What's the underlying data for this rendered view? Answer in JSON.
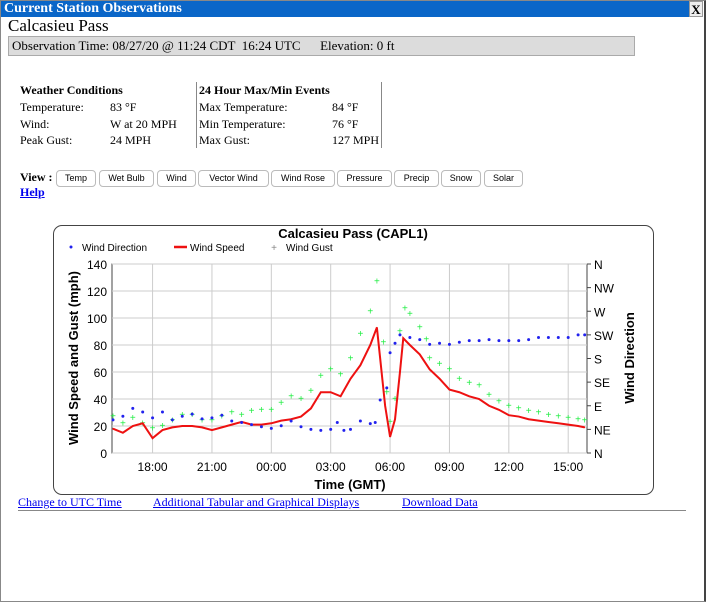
{
  "window": {
    "title": "Current Station Observations",
    "close": "X"
  },
  "station": "Calcasieu Pass",
  "obs_line": "Observation Time: 08/27/20 @ 11:24 CDT  16:24 UTC      Elevation: 0 ft",
  "conditions": {
    "heading": "Weather Conditions",
    "rows": [
      [
        "Temperature:",
        "83 °F"
      ],
      [
        "Wind:",
        "W at 20 MPH"
      ],
      [
        "Peak Gust:",
        "24 MPH"
      ]
    ]
  },
  "extremes": {
    "heading": "24 Hour Max/Min Events",
    "rows": [
      [
        "Max Temperature:",
        "84 °F"
      ],
      [
        "Min Temperature:",
        "76 °F"
      ],
      [
        "Max Gust:",
        "127 MPH"
      ]
    ]
  },
  "view": {
    "label": "View :",
    "buttons": [
      "Temp",
      "Wet Bulb",
      "Wind",
      "Vector Wind",
      "Wind Rose",
      "Pressure",
      "Precip",
      "Snow",
      "Solar"
    ],
    "help": "Help"
  },
  "links": [
    "Change to UTC Time",
    "Additional Tabular and Graphical Displays",
    "Download Data"
  ],
  "chart_data": {
    "type": "line",
    "title": "Calcasieu Pass (CAPL1)",
    "xlabel": "Time (GMT)",
    "ylabel": "Wind Speed and Gust (mph)",
    "y2label": "Wind Direction",
    "ylim": [
      0,
      140
    ],
    "yticks": [
      0,
      20,
      40,
      60,
      80,
      100,
      120,
      140
    ],
    "y2ticks": [
      "N",
      "NE",
      "E",
      "SE",
      "S",
      "SW",
      "W",
      "NW",
      "N"
    ],
    "xticks": [
      "18:00",
      "21:00",
      "00:00",
      "03:00",
      "06:00",
      "09:00",
      "12:00",
      "15:00"
    ],
    "grid": true,
    "legend": "top",
    "colors": {
      "direction": "#2222ee",
      "speed": "#ee1111",
      "gust": "#22ee44"
    },
    "series": [
      {
        "name": "Wind Direction",
        "marker": "dot",
        "unit": "deg",
        "points": [
          [
            "16:00",
            63
          ],
          [
            "16:30",
            70
          ],
          [
            "17:00",
            85
          ],
          [
            "17:30",
            78
          ],
          [
            "18:00",
            67
          ],
          [
            "18:30",
            78
          ],
          [
            "19:00",
            63
          ],
          [
            "19:30",
            70
          ],
          [
            "20:00",
            74
          ],
          [
            "20:30",
            65
          ],
          [
            "21:00",
            67
          ],
          [
            "21:30",
            72
          ],
          [
            "22:00",
            61
          ],
          [
            "22:30",
            58
          ],
          [
            "23:00",
            54
          ],
          [
            "23:30",
            50
          ],
          [
            "00:00",
            47
          ],
          [
            "00:30",
            52
          ],
          [
            "01:00",
            61
          ],
          [
            "01:30",
            50
          ],
          [
            "02:00",
            45
          ],
          [
            "02:30",
            43
          ],
          [
            "03:00",
            45
          ],
          [
            "03:20",
            58
          ],
          [
            "03:40",
            43
          ],
          [
            "04:00",
            45
          ],
          [
            "04:30",
            61
          ],
          [
            "05:00",
            56
          ],
          [
            "05:15",
            58
          ],
          [
            "05:30",
            101
          ],
          [
            "05:50",
            124
          ],
          [
            "06:00",
            191
          ],
          [
            "06:15",
            209
          ],
          [
            "06:30",
            225
          ],
          [
            "07:00",
            220
          ],
          [
            "07:30",
            216
          ],
          [
            "08:00",
            207
          ],
          [
            "08:30",
            209
          ],
          [
            "09:00",
            207
          ],
          [
            "09:30",
            211
          ],
          [
            "10:00",
            214
          ],
          [
            "10:30",
            214
          ],
          [
            "11:00",
            216
          ],
          [
            "11:30",
            214
          ],
          [
            "12:00",
            214
          ],
          [
            "12:30",
            214
          ],
          [
            "13:00",
            216
          ],
          [
            "13:30",
            220
          ],
          [
            "14:00",
            220
          ],
          [
            "14:30",
            220
          ],
          [
            "15:00",
            220
          ],
          [
            "15:30",
            225
          ],
          [
            "15:50",
            225
          ]
        ]
      },
      {
        "name": "Wind Speed",
        "marker": "line",
        "unit": "mph",
        "points": [
          [
            "16:00",
            18
          ],
          [
            "16:30",
            15
          ],
          [
            "17:00",
            20
          ],
          [
            "17:30",
            22
          ],
          [
            "18:00",
            11
          ],
          [
            "18:30",
            17
          ],
          [
            "19:00",
            19
          ],
          [
            "19:30",
            20
          ],
          [
            "20:00",
            20
          ],
          [
            "20:30",
            19
          ],
          [
            "21:00",
            17
          ],
          [
            "21:30",
            19
          ],
          [
            "22:00",
            21
          ],
          [
            "22:30",
            23
          ],
          [
            "23:00",
            21
          ],
          [
            "23:30",
            21
          ],
          [
            "00:00",
            22
          ],
          [
            "00:30",
            24
          ],
          [
            "01:00",
            25
          ],
          [
            "01:30",
            27
          ],
          [
            "02:00",
            33
          ],
          [
            "02:30",
            45
          ],
          [
            "03:00",
            45
          ],
          [
            "03:30",
            42
          ],
          [
            "04:00",
            55
          ],
          [
            "04:30",
            65
          ],
          [
            "05:00",
            80
          ],
          [
            "05:20",
            93
          ],
          [
            "05:30",
            70
          ],
          [
            "05:45",
            35
          ],
          [
            "06:00",
            12
          ],
          [
            "06:15",
            25
          ],
          [
            "06:30",
            60
          ],
          [
            "06:40",
            85
          ],
          [
            "07:00",
            80
          ],
          [
            "07:30",
            73
          ],
          [
            "08:00",
            62
          ],
          [
            "08:30",
            55
          ],
          [
            "09:00",
            47
          ],
          [
            "09:30",
            45
          ],
          [
            "10:00",
            42
          ],
          [
            "10:30",
            40
          ],
          [
            "11:00",
            35
          ],
          [
            "11:30",
            32
          ],
          [
            "12:00",
            28
          ],
          [
            "12:30",
            27
          ],
          [
            "13:00",
            25
          ],
          [
            "13:30",
            24
          ],
          [
            "14:00",
            23
          ],
          [
            "14:30",
            22
          ],
          [
            "15:00",
            21
          ],
          [
            "15:30",
            20
          ],
          [
            "15:50",
            19
          ]
        ]
      },
      {
        "name": "Wind Gust",
        "marker": "plus",
        "unit": "mph",
        "points": [
          [
            "16:00",
            27
          ],
          [
            "16:30",
            22
          ],
          [
            "17:00",
            26
          ],
          [
            "17:30",
            22
          ],
          [
            "18:00",
            18
          ],
          [
            "18:30",
            20
          ],
          [
            "19:00",
            24
          ],
          [
            "19:30",
            28
          ],
          [
            "20:00",
            28
          ],
          [
            "20:30",
            24
          ],
          [
            "21:00",
            24
          ],
          [
            "21:30",
            27
          ],
          [
            "22:00",
            30
          ],
          [
            "22:30",
            28
          ],
          [
            "23:00",
            31
          ],
          [
            "23:30",
            32
          ],
          [
            "00:00",
            32
          ],
          [
            "00:30",
            37
          ],
          [
            "01:00",
            42
          ],
          [
            "01:30",
            40
          ],
          [
            "02:00",
            46
          ],
          [
            "02:30",
            57
          ],
          [
            "03:00",
            62
          ],
          [
            "03:30",
            58
          ],
          [
            "04:00",
            70
          ],
          [
            "04:30",
            88
          ],
          [
            "05:00",
            105
          ],
          [
            "05:20",
            127
          ],
          [
            "05:40",
            82
          ],
          [
            "05:50",
            45
          ],
          [
            "06:00",
            23
          ],
          [
            "06:15",
            40
          ],
          [
            "06:30",
            90
          ],
          [
            "06:45",
            107
          ],
          [
            "07:00",
            103
          ],
          [
            "07:30",
            93
          ],
          [
            "07:50",
            84
          ],
          [
            "08:00",
            70
          ],
          [
            "08:30",
            66
          ],
          [
            "09:00",
            62
          ],
          [
            "09:30",
            55
          ],
          [
            "10:00",
            52
          ],
          [
            "10:30",
            50
          ],
          [
            "11:00",
            43
          ],
          [
            "11:30",
            38
          ],
          [
            "12:00",
            35
          ],
          [
            "12:30",
            33
          ],
          [
            "13:00",
            31
          ],
          [
            "13:30",
            30
          ],
          [
            "14:00",
            28
          ],
          [
            "14:30",
            27
          ],
          [
            "15:00",
            26
          ],
          [
            "15:30",
            25
          ],
          [
            "15:50",
            24
          ]
        ]
      }
    ]
  }
}
